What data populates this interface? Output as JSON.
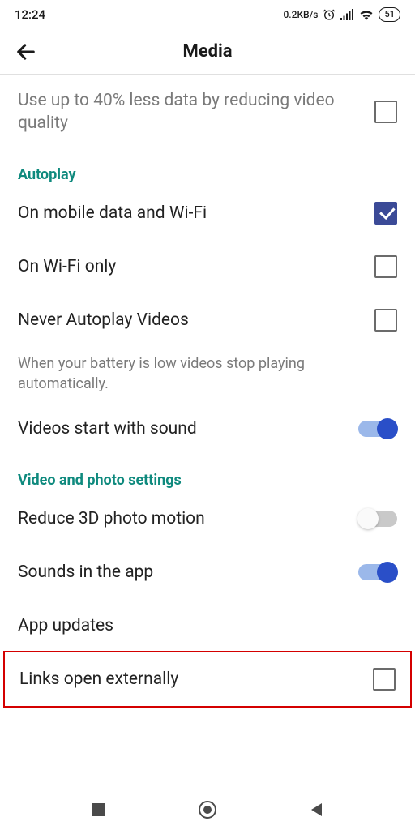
{
  "status": {
    "time": "12:24",
    "data_rate": "0.2KB/s",
    "battery": "51"
  },
  "header": {
    "title": "Media"
  },
  "settings": {
    "data_saver": "Use up to 40% less data by reducing video quality",
    "autoplay_section": "Autoplay",
    "autoplay_mobile_wifi": "On mobile data and Wi-Fi",
    "autoplay_wifi_only": "On Wi-Fi only",
    "autoplay_never": "Never Autoplay Videos",
    "battery_note": "When your battery is low videos stop playing automatically.",
    "sound_start": "Videos start with sound",
    "video_section": "Video and photo settings",
    "reduce_3d": "Reduce 3D photo motion",
    "sounds_app": "Sounds in the app",
    "app_updates": "App updates",
    "links_external": "Links open externally"
  },
  "states": {
    "data_saver_checked": false,
    "autoplay_mobile_wifi_checked": true,
    "autoplay_wifi_only_checked": false,
    "autoplay_never_checked": false,
    "sound_start_on": true,
    "reduce_3d_on": false,
    "sounds_app_on": true,
    "links_external_checked": false
  }
}
